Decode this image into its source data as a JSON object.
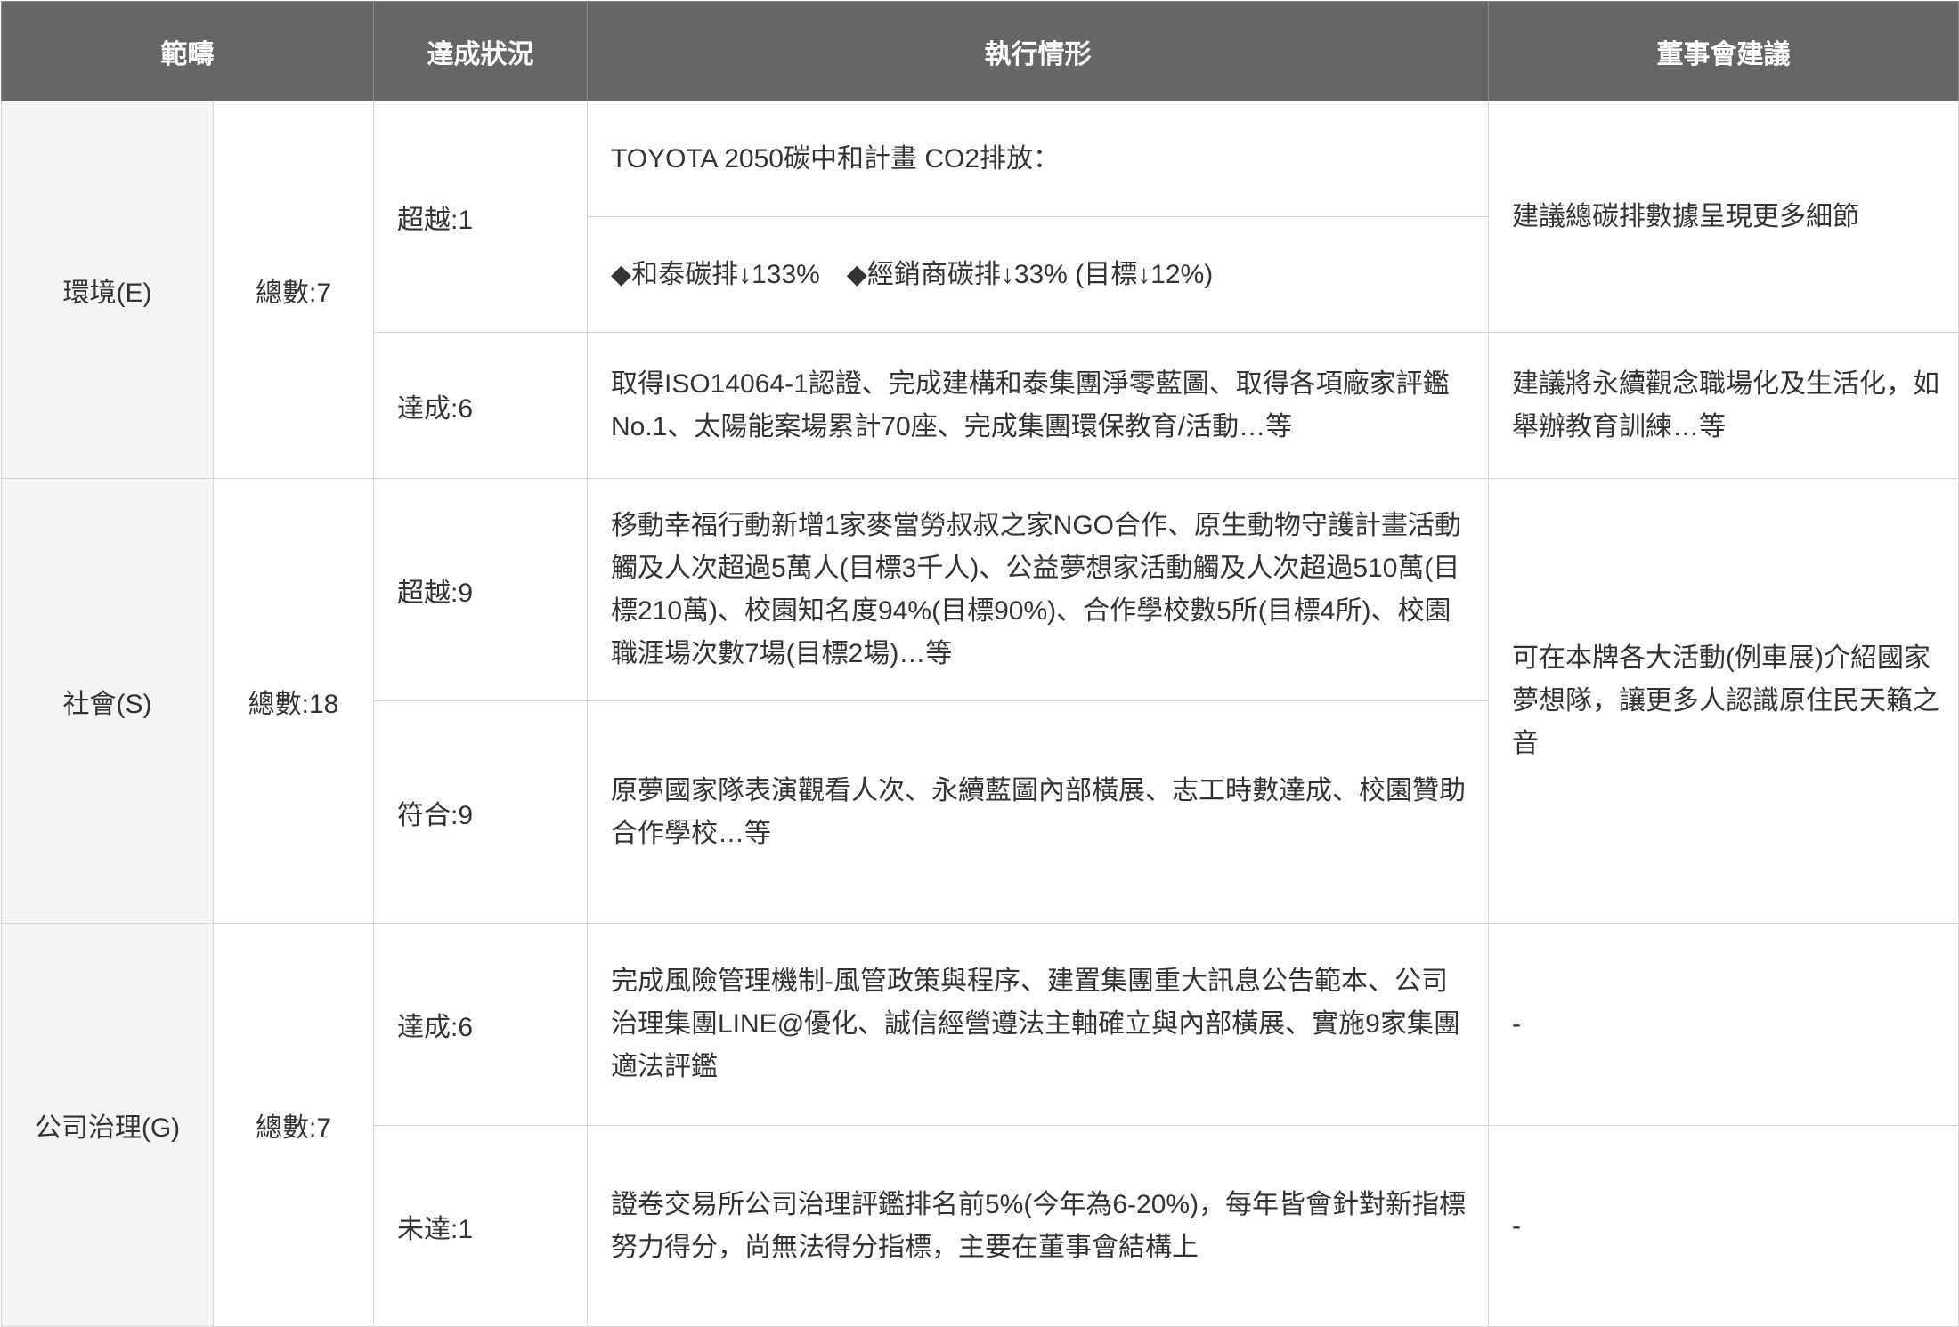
{
  "header": {
    "scope": "範疇",
    "status": "達成狀況",
    "execution": "執行情形",
    "board_advice": "董事會建議"
  },
  "environment": {
    "category": "環境(E)",
    "total": "總數:7",
    "exceed": "超越:1",
    "exceed_line1": "TOYOTA 2050碳中和計畫 CO2排放：",
    "exceed_line2": "◆和泰碳排↓133%　◆經銷商碳排↓33% (目標↓12%)",
    "exceed_advice": "建議總碳排數據呈現更多細節",
    "achieve": "達成:6",
    "achieve_detail": "取得ISO14064-1認證、完成建構和泰集團淨零藍圖、取得各項廠家評鑑No.1、太陽能案場累計70座、完成集團環保教育/活動…等",
    "achieve_advice": "建議將永續觀念職場化及生活化，如舉辦教育訓練…等"
  },
  "social": {
    "category": "社會(S)",
    "total": "總數:18",
    "exceed": "超越:9",
    "exceed_detail": "移動幸福行動新增1家麥當勞叔叔之家NGO合作、原生動物守護計畫活動觸及人次超過5萬人(目標3千人)、公益夢想家活動觸及人次超過510萬(目標210萬)、校園知名度94%(目標90%)、合作學校數5所(目標4所)、校園職涯場次數7場(目標2場)…等",
    "meet": "符合:9",
    "meet_detail": "原夢國家隊表演觀看人次、永續藍圖內部橫展、志工時數達成、校園贊助合作學校…等",
    "advice": "可在本牌各大活動(例車展)介紹國家夢想隊，讓更多人認識原住民天籟之音"
  },
  "governance": {
    "category": "公司治理(G)",
    "total": "總數:7",
    "achieve": "達成:6",
    "achieve_detail": "完成風險管理機制-風管政策與程序、建置集團重大訊息公告範本、公司治理集團LINE@優化、誠信經營遵法主軸確立與內部橫展、實施9家集團適法評鑑",
    "achieve_advice": "-",
    "unmet": "未達:1",
    "unmet_detail": "證卷交易所公司治理評鑑排名前5%(今年為6-20%)，每年皆會針對新指標努力得分，尚無法得分指標，主要在董事會結構上",
    "unmet_advice": "-"
  }
}
